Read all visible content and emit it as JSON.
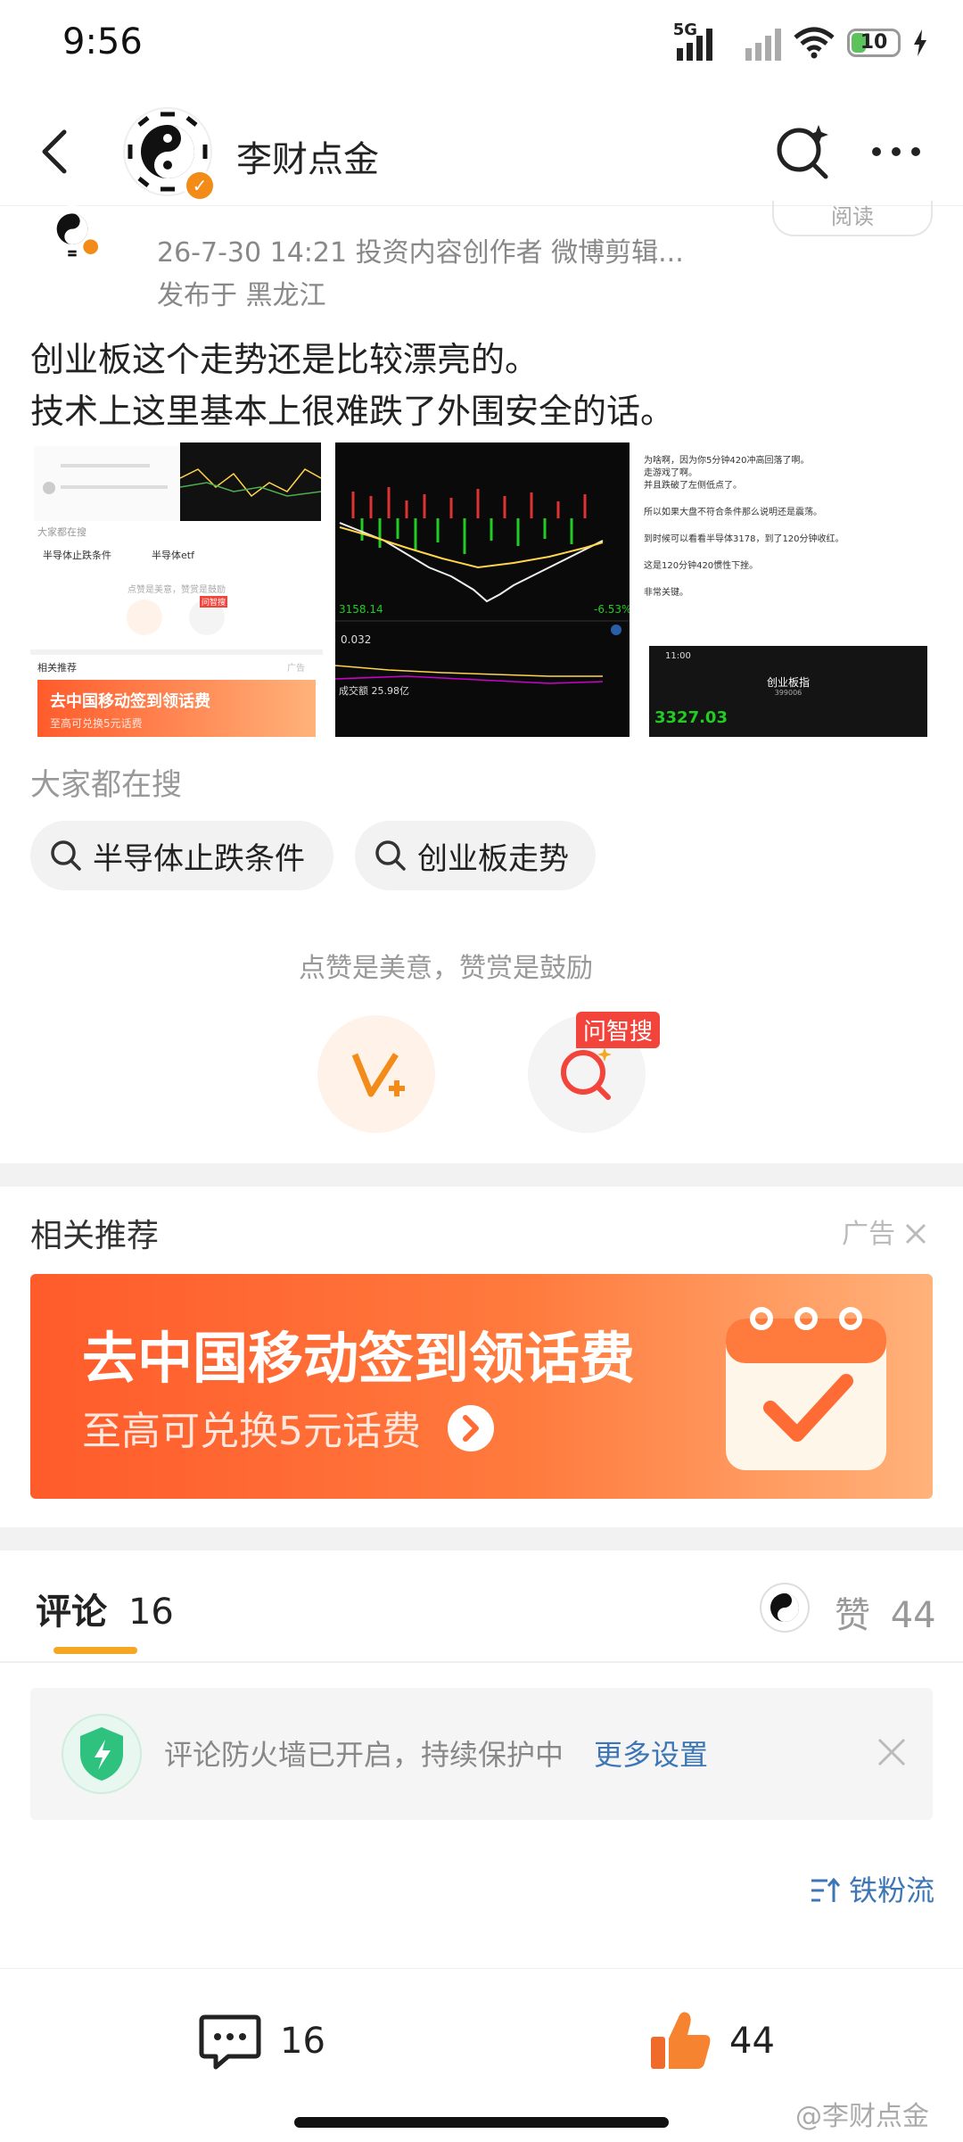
{
  "status": {
    "time": "9:56",
    "network": "5G",
    "battery": "10"
  },
  "header": {
    "title": "李财点金"
  },
  "post": {
    "meta": "26-7-30 14:21  投资内容创作者 微博剪辑...",
    "location": "发布于 黑龙江",
    "read_label": "阅读",
    "text_line1": "创业板这个走势还是比较漂亮的。",
    "text_line2": "技术上这里基本上很难跌了外围安全的话。"
  },
  "thumb1": {
    "search_head": "大家都在搜",
    "chip_a": "半导体止跌条件",
    "chip_b": "半导体etf",
    "tip": "点赞是美意，赞赏是鼓励",
    "badge": "问智搜",
    "rec": "相关推荐",
    "ad": "广告",
    "banner1": "去中国移动签到领话费",
    "banner2": "至高可兑换5元话费"
  },
  "thumb2": {
    "index": "3158.14",
    "pct": "-6.53%",
    "v1": "0.032",
    "vol": "成交额 25.98亿"
  },
  "thumb3": {
    "lines": [
      "为啥啊，因为你5分钟420冲高回落了啊。",
      "走游戏了啊。",
      "并且跌破了左侧低点了。",
      "所以如果大盘不符合条件那么说明还是震荡。",
      "到时候可以看看半导体3178，到了120分钟收红。",
      "这是120分钟420惯性下挫。",
      "非常关键。"
    ],
    "phone_time": "11:00",
    "board": "创业板指",
    "code": "399006",
    "price": "3327.03"
  },
  "search_section": {
    "heading": "大家都在搜",
    "chips": [
      "半导体止跌条件",
      "创业板走势"
    ]
  },
  "reward": {
    "tip": "点赞是美意，赞赏是鼓励",
    "ask_badge": "问智搜"
  },
  "recommend": {
    "title": "相关推荐",
    "ad_label": "广告",
    "banner_line1": "去中国移动签到领话费",
    "banner_line2": "至高可兑换5元话费"
  },
  "comments": {
    "tab_label": "评论",
    "count": "16",
    "likes_label": "赞",
    "likes_count": "44"
  },
  "firewall": {
    "text": "评论防火墙已开启，持续保护中",
    "link": "更多设置"
  },
  "sort": {
    "label": "铁粉流"
  },
  "bottom": {
    "comment_count": "16",
    "like_count": "44",
    "watermark": "@李财点金"
  },
  "colors": {
    "accent_orange": "#f5a623",
    "link_blue": "#3d76b5",
    "ad_red": "#ff5b2b",
    "badge_red": "#f2443b"
  }
}
